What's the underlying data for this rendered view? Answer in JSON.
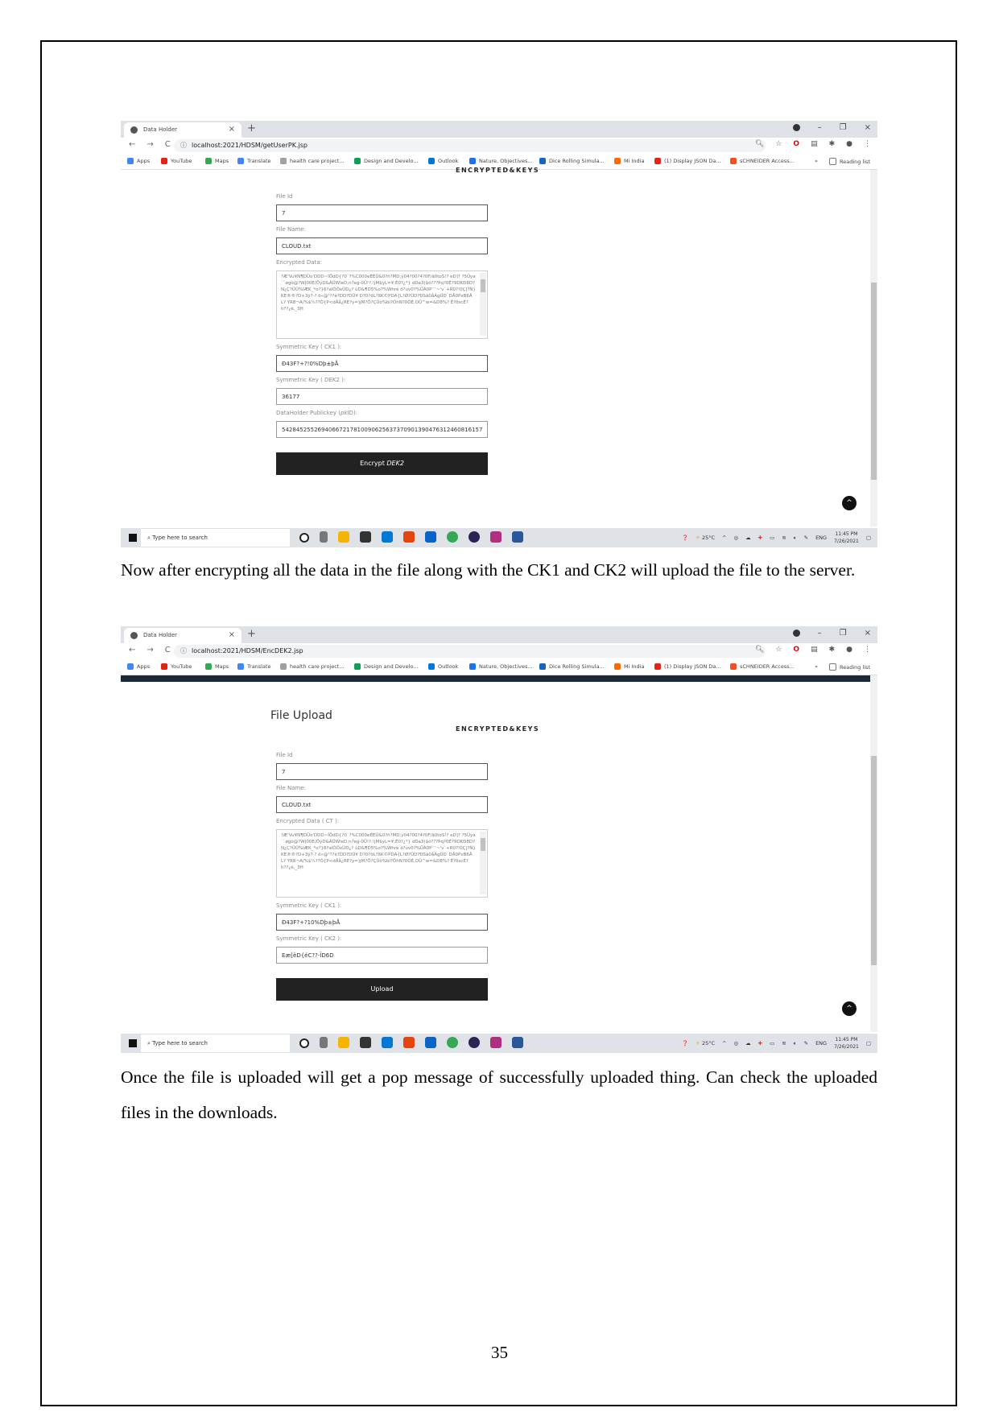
{
  "document": {
    "page_number": "35",
    "paragraphs": [
      "Now after encrypting all the data in the file along with the CK1 and CK2 will upload the file to the server.",
      "Once the file is uploaded will get a pop message of successfully uploaded thing. Can check the uploaded files in the downloads."
    ]
  },
  "browser": {
    "tab_title": "Data Holder",
    "tab_close": "×",
    "new_tab": "+",
    "window_controls": {
      "minimize": "–",
      "maximize": "❐",
      "close": "×"
    },
    "nav": {
      "back": "←",
      "forward": "→",
      "reload": "C"
    },
    "bookmarks": [
      {
        "label": "Apps",
        "icon": "apps-grid-icon",
        "color": "#4285f4"
      },
      {
        "label": "YouTube",
        "icon": "youtube-icon",
        "color": "#e62117"
      },
      {
        "label": "Maps",
        "icon": "maps-icon",
        "color": "#34a853"
      },
      {
        "label": "Translate",
        "icon": "translate-icon",
        "color": "#4285f4"
      },
      {
        "label": "health care project...",
        "icon": "page-icon",
        "color": "#9aa0a6"
      },
      {
        "label": "Design and Develo...",
        "icon": "design-icon",
        "color": "#0f9d58"
      },
      {
        "label": "Outlook",
        "icon": "outlook-icon",
        "color": "#0078d4"
      },
      {
        "label": "Nature, Objectives...",
        "icon": "nature-icon",
        "color": "#1a73e8"
      },
      {
        "label": "Dice Rolling Simula...",
        "icon": "dice-icon",
        "color": "#1565c0"
      },
      {
        "label": "Mi India",
        "icon": "mi-icon",
        "color": "#ff6900"
      },
      {
        "label": "(1) Display JSON Da...",
        "icon": "youtube-icon",
        "color": "#e62117"
      },
      {
        "label": "sCHNEIDER Access...",
        "icon": "windows-icon",
        "color": "#f25022"
      }
    ],
    "bookmarks_overflow": "»",
    "reading_list": "Reading list"
  },
  "screenshot1": {
    "url": "localhost:2021/HDSM/getUserPK.jsp",
    "brand": "ENCRYPTED&KEYS",
    "fields": [
      {
        "label": "File Id",
        "value": "7"
      },
      {
        "label": "File Name:",
        "value": "CLOUD.txt"
      }
    ],
    "encrypted_label": "Encrypted Data:",
    "encrypted_value": "?Æ'Vu¥N¶DÜo'DDD~ÍÖdD{?0`?%C000eÉÉÜ&0?ñ?MD;ý04?00?4?0F/ã0toS!? eD]? ?5Ûya``øgò@?W|00E/ÖýD&ÃÜWleD;n?eg-0Ü!?.!jM$yL=¥;É0?¿*} dDa3)$ó???Þq?0É?9DKÐ8D? N¿Ç?ÜÜ%IÆK_*o?}6?alÓÕxÜD¿? ùD&¶D5%o?%Whré   ô?uv0?%ÜÀ0P¯¯~'v`+R0?!0Ç|?Ñ}KE®®?D+3ÿ?-? ö«@¹??è?DD?DÜ¥    D?0?öL?ßK©PDA{L?Ø?ÜD?ÐSã0åÀgÜD`DÅ0PxB6ÂL? YR8¬A/%$¼??Ò{P<dÂå¿RE?y=)jM?Ö?ÇÜò%bì?ÕñN?0ÕÉ,OÜ^w=&D8%? È?ðscÉ?h??¿é,_3H",
    "ck1_label": "Symmetric Key ( CK1 ):",
    "ck1_value": "Ð43F?+?!0%Dþ±þÅ",
    "dek2_label": "Symmetric Key ( DEK2 ):",
    "dek2_value": "36177",
    "pk_label_prefix": "DataHolder Publickey (",
    "pk_label_italic": "pk",
    "pk_label_suffix": "ID):",
    "pk_value": "54284525526940667217810090625637370901390476312460816157",
    "button_prefix": "Encrypt ",
    "button_italic": "DEK2"
  },
  "screenshot2": {
    "url": "localhost:2021/HDSM/EncDEK2.jsp",
    "heading": "File Upload",
    "brand": "ENCRYPTED&KEYS",
    "fields": [
      {
        "label": "File Id",
        "value": "7"
      },
      {
        "label": "File Name:",
        "value": "CLOUD.txt"
      }
    ],
    "encrypted_label": "Encrypted Data ( CT ):",
    "encrypted_value": "?Æ'Vu¥N¶DÜo'DDD~ÍÖdD{?0`?%C000eÉÉÜ&0?ñ?MD;ý04?00?4?0F/ã0toS!? eD]? ?5Ûya``øgò@?W|00E/ÖýD&ÃÜWleD;n?eg-0Ü!?.!jM$yL=¥;É0?¿*} dDa3)$ó???Þq?0É?9DKÐ8D? N¿Ç?ÜÜ%IÆK_*o?}6?alÓÕxÜD¿? ùD&¶D5%o?%Whré   ô?uv0?%ÜÀ0P¯¯~'v`+R0?!0Ç|?Ñ}KE®®?D+3ÿ?-? ö«@¹??è?DD?DÜ¥    D?0?öL?ßK©PDA{L?Ø?ÜD?ÐSã0åÀgÜD`DÅ0PxB6ÂL? YR8¬A/%$¼??Ò{P<dÂå¿RE?y=)jM?Ö?ÇÜò%bì?ÕñN?0ÕÉ,OÜ^w=&D8%? È?ðscÉ?h??¿é,_3H",
    "ck1_label": "Symmetric Key ( CK1 ):",
    "ck1_value": "Ð43F?+?10%Dþ±þÅ",
    "ck2_label": "Symmetric Key ( CK2 ):",
    "ck2_value": "Eæ[ëD{éC??-ÎD6D",
    "button_label": "Upload"
  },
  "taskbar": {
    "search_placeholder": "Type here to search",
    "weather": "25°C",
    "language": "ENG",
    "time": "11:45 PM",
    "date": "7/26/2021",
    "apps": [
      {
        "name": "cortana-icon",
        "color": "#222222"
      },
      {
        "name": "task-view-icon",
        "color": "#555555"
      },
      {
        "name": "file-explorer-icon",
        "color": "#f4b400"
      },
      {
        "name": "store-icon",
        "color": "#333333"
      },
      {
        "name": "outlook-app-icon",
        "color": "#0078d4"
      },
      {
        "name": "office-icon",
        "color": "#e3450f"
      },
      {
        "name": "mail-icon",
        "color": "#0a64c8"
      },
      {
        "name": "chrome-icon",
        "color": "#34a853"
      },
      {
        "name": "eclipse-icon",
        "color": "#2c2255"
      },
      {
        "name": "paint-icon",
        "color": "#b03080"
      },
      {
        "name": "word-icon",
        "color": "#2b579a"
      }
    ]
  }
}
